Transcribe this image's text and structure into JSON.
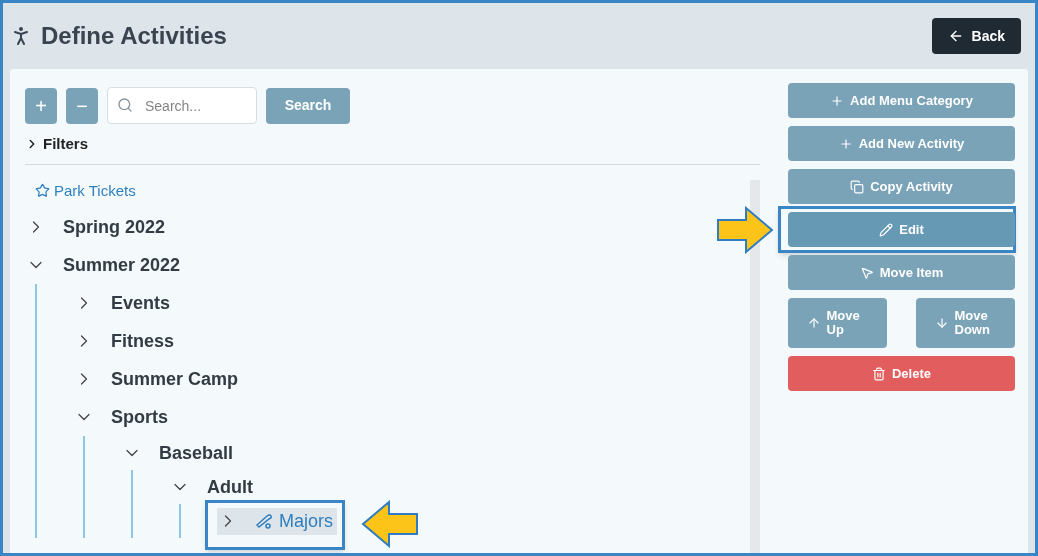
{
  "header": {
    "title": "Define Activities",
    "back": "Back"
  },
  "toolbar": {
    "expand": "+",
    "collapse": "−",
    "search": {
      "placeholder": "Search..."
    },
    "search_button": "Search",
    "filters": {
      "label": "Filters",
      "expanded": false
    }
  },
  "favorite": "Park Tickets",
  "tree": [
    {
      "label": "Spring 2022",
      "expanded": false,
      "selected": false
    },
    {
      "label": "Summer 2022",
      "expanded": true,
      "selected": false,
      "children": [
        {
          "label": "Events",
          "expanded": false,
          "selected": false
        },
        {
          "label": "Fitness",
          "expanded": false,
          "selected": false
        },
        {
          "label": "Summer Camp",
          "expanded": false,
          "selected": false
        },
        {
          "label": "Sports",
          "expanded": true,
          "selected": false,
          "children": [
            {
              "label": "Baseball",
              "expanded": true,
              "selected": false,
              "children": [
                {
                  "label": "Adult",
                  "expanded": true,
                  "selected": false,
                  "children": [
                    {
                      "label": "Majors",
                      "expanded": false,
                      "selected": true,
                      "kind": "activity"
                    }
                  ]
                }
              ]
            }
          ]
        }
      ]
    }
  ],
  "actions": [
    [
      {
        "label": "Add Menu Category",
        "kind": "primary",
        "highlighted": false
      }
    ],
    [
      {
        "label": "Add New Activity",
        "kind": "primary",
        "highlighted": false
      }
    ],
    [
      {
        "label": "Copy Activity",
        "kind": "primary",
        "highlighted": false
      }
    ],
    [
      {
        "label": "Edit",
        "kind": "primary",
        "highlighted": true
      }
    ],
    [
      {
        "label": "Move Item",
        "kind": "primary",
        "highlighted": false
      }
    ],
    [
      {
        "label": "Move Up",
        "kind": "primary",
        "highlighted": false
      },
      {
        "label": "Move Down",
        "kind": "primary",
        "highlighted": false
      }
    ],
    [
      {
        "label": "Delete",
        "kind": "danger",
        "highlighted": false
      }
    ]
  ]
}
